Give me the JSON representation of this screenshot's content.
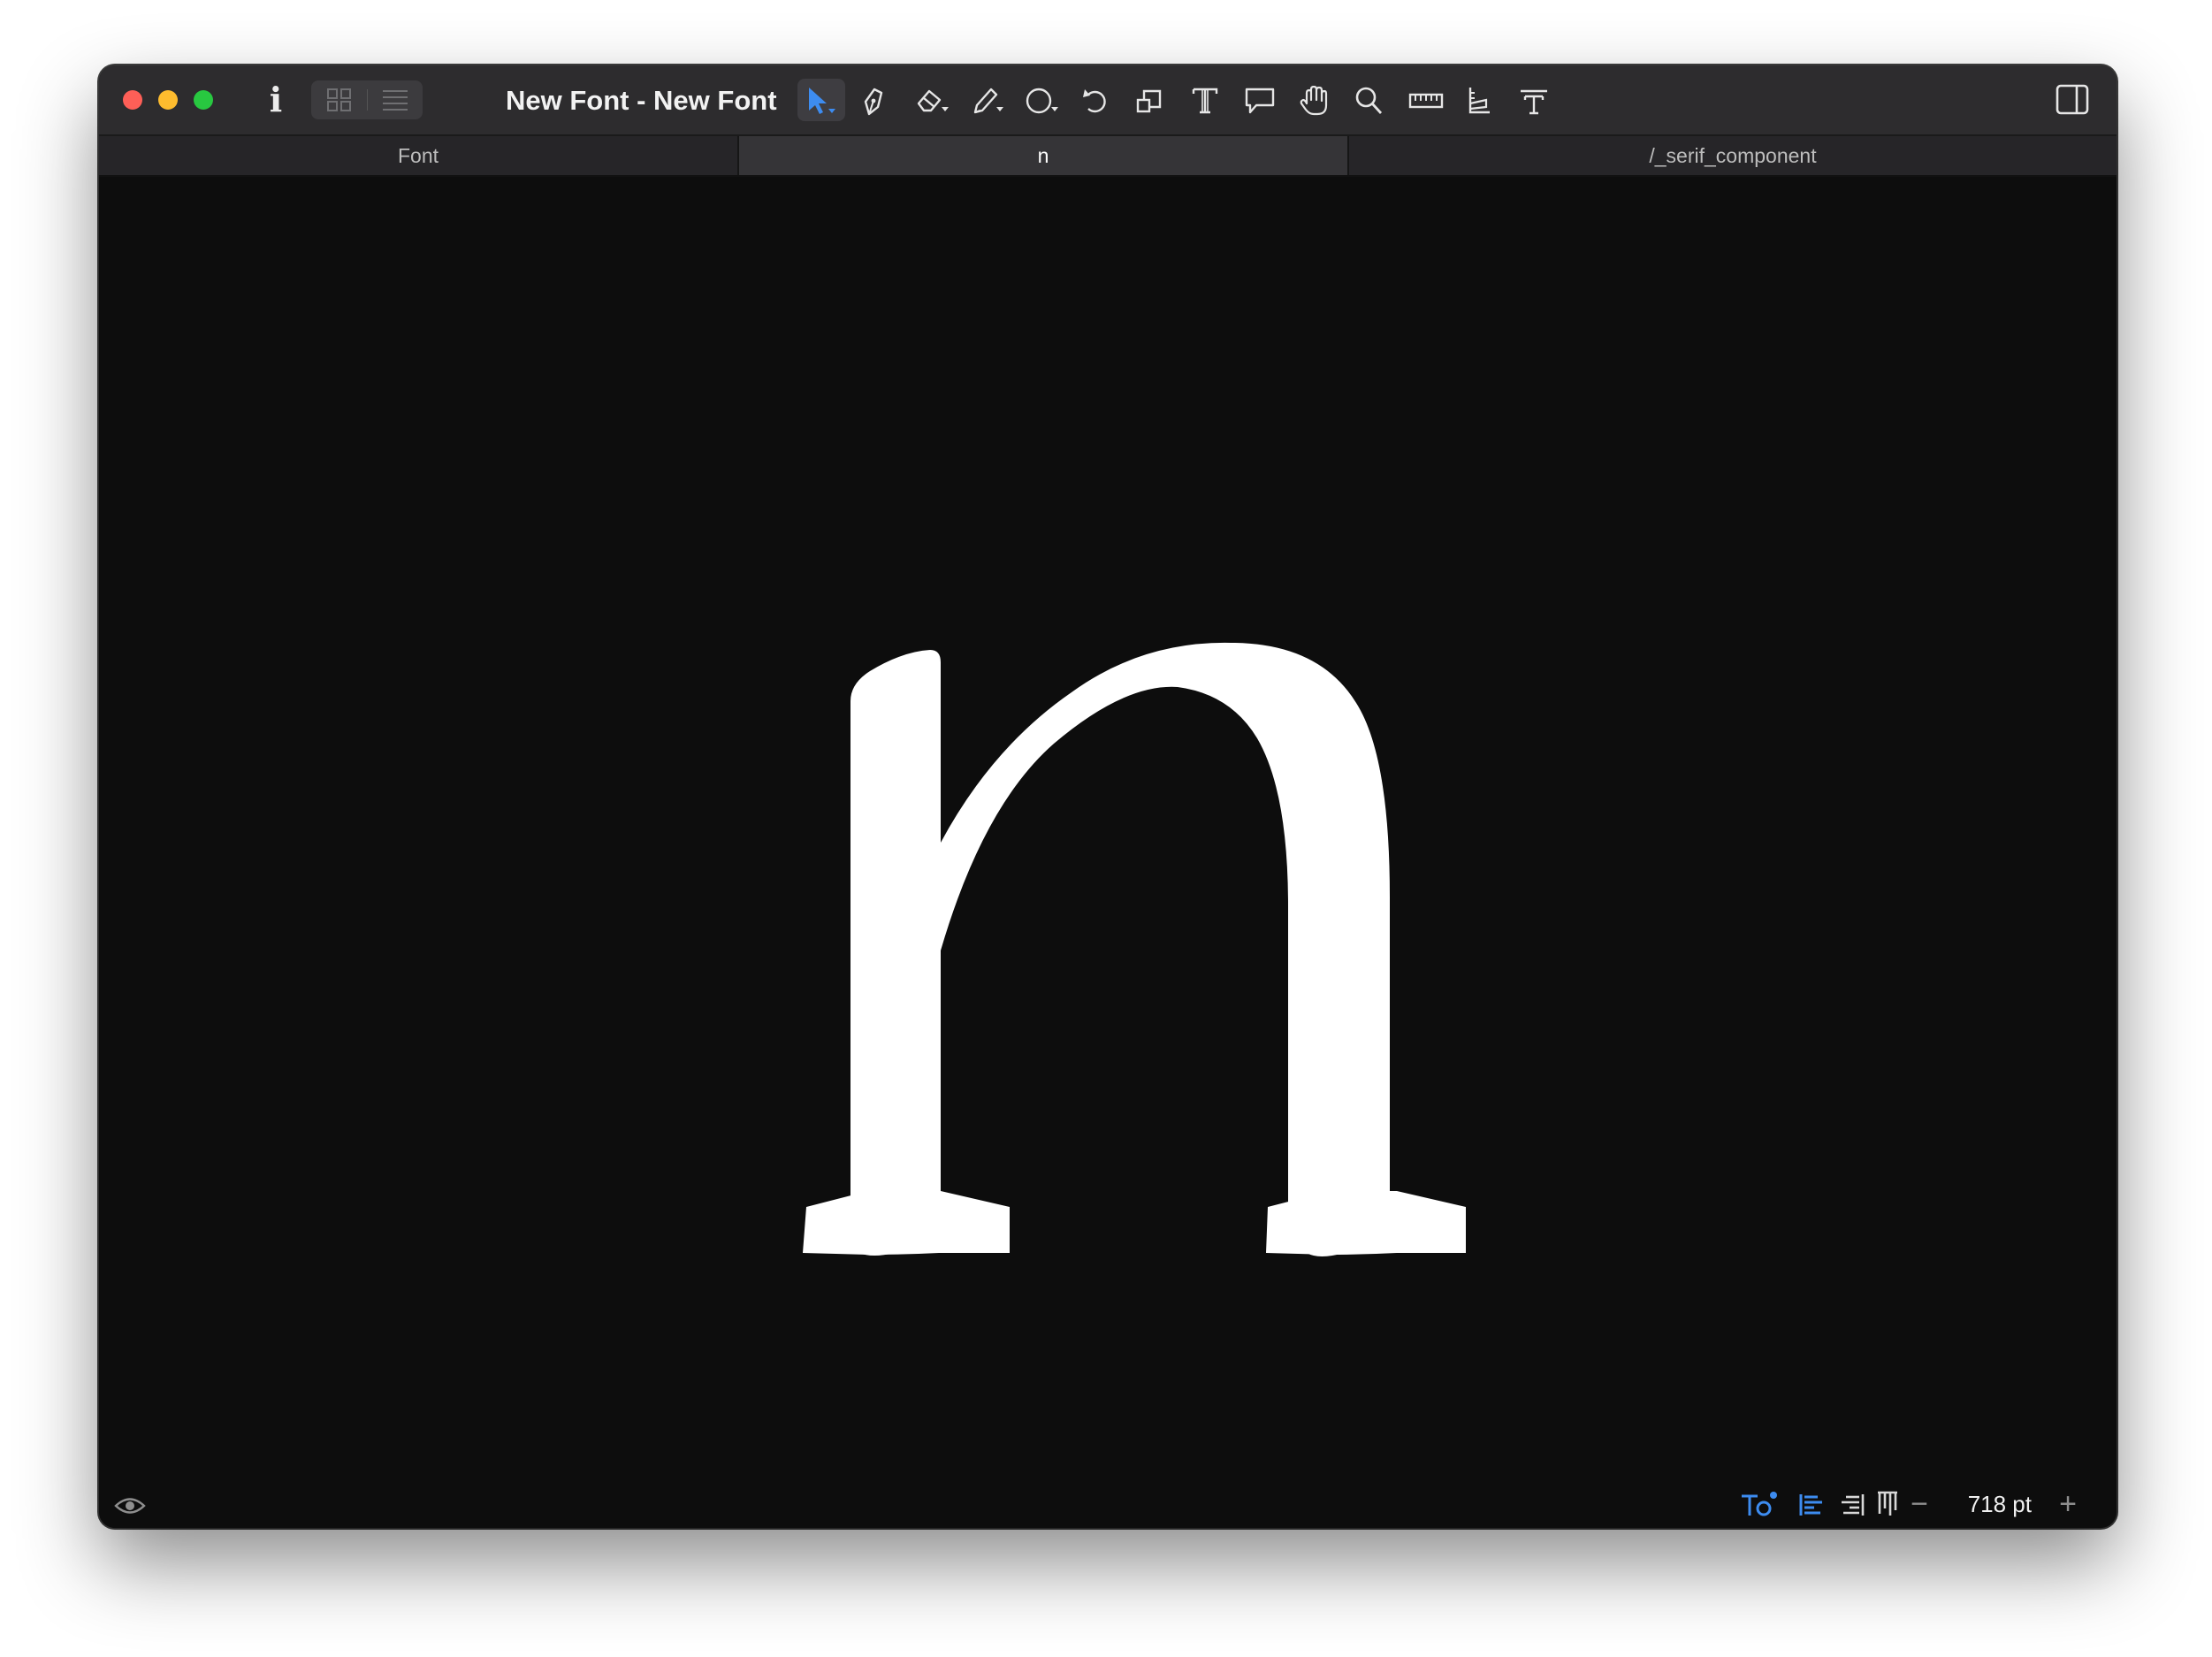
{
  "window": {
    "title": "New Font - New Font"
  },
  "view_modes": [
    {
      "name": "grid-view",
      "icon": "grid-icon"
    },
    {
      "name": "list-view",
      "icon": "list-icon"
    }
  ],
  "toolbar": {
    "tools": [
      {
        "id": "select",
        "icon": "select-arrow-icon",
        "active": true
      },
      {
        "id": "draw",
        "icon": "pen-icon",
        "active": false
      },
      {
        "id": "eraser",
        "icon": "eraser-icon",
        "active": false
      },
      {
        "id": "pencil",
        "icon": "pencil-icon",
        "active": false
      },
      {
        "id": "primitives",
        "icon": "circle-shape-icon",
        "active": false
      },
      {
        "id": "rotate",
        "icon": "rotate-icon",
        "active": false
      },
      {
        "id": "scale",
        "icon": "scale-icon",
        "active": false
      },
      {
        "id": "text",
        "icon": "text-tool-icon",
        "active": false
      },
      {
        "id": "annotation",
        "icon": "speech-bubble-icon",
        "active": false
      },
      {
        "id": "hand",
        "icon": "hand-icon",
        "active": false
      },
      {
        "id": "zoom",
        "icon": "magnifier-icon",
        "active": false
      },
      {
        "id": "measure",
        "icon": "ruler-icon",
        "active": false
      },
      {
        "id": "knife",
        "icon": "knife-icon",
        "active": false
      },
      {
        "id": "text-metrics",
        "icon": "text-metrics-icon",
        "active": false
      }
    ]
  },
  "tabs": [
    {
      "label": "Font",
      "active": false
    },
    {
      "label": "n",
      "active": true
    },
    {
      "label": "/_serif_component",
      "active": false
    }
  ],
  "canvas": {
    "glyph": "n",
    "glyph_color": "#ffffff",
    "background": "#0d0d0d"
  },
  "statusbar": {
    "preview_icon": "eye-icon",
    "text_tool_icon": "text-preview-icon",
    "align_left_icon": "align-left-icon",
    "align_right_icon": "align-right-icon",
    "vertical_icon": "vertical-text-icon",
    "zoom_minus": "−",
    "zoom_value": "718 pt",
    "zoom_plus": "+"
  },
  "colors": {
    "accent": "#3d8cf0",
    "titlebar": "#2d2c2e"
  }
}
